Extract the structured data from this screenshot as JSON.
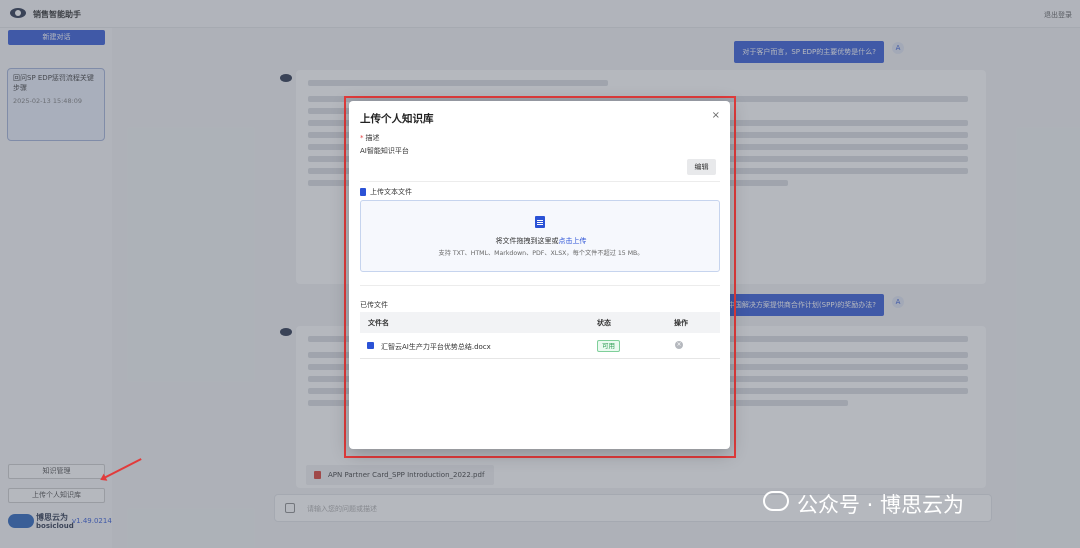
{
  "app": {
    "title": "销售智能助手",
    "logout_label": "退出登录"
  },
  "sidebar": {
    "new_chat_label": "新建对话",
    "history": [
      {
        "title": "回问SP EDP惩罚流程关键步骤",
        "time": "2025-02-13 15:48:09"
      }
    ],
    "knowledge_btn_label": "知识管理",
    "upload_personal_label": "上传个人知识库",
    "brand_name": "博思云为",
    "brand_sub": "bosicloud",
    "version": "v1.49.0214"
  },
  "chat": {
    "user_question_1": "对于客户而言，SP EDP的主要优势是什么?",
    "user_question_2": "中国解决方案提供商合作计划(SPP)的奖励办法?",
    "user_avatar": "A",
    "attachment_file": "APN Partner Card_SPP Introduction_2022.pdf",
    "input_placeholder": "请输入您的问题或描述"
  },
  "modal": {
    "title": "上传个人知识库",
    "close_icon": "×",
    "description_label": "描述",
    "description_required_mark": "*",
    "description_value": "AI智能知识平台",
    "edit_button": "编辑",
    "upload_section_label": "上传文本文件",
    "dropzone_text": "将文件拖拽到这里或",
    "dropzone_link": "点击上传",
    "dropzone_hint": "支持 TXT、HTML、Markdown、PDF、XLSX，每个文件不超过 15 MB。",
    "files_section_label": "已传文件",
    "table_headers": {
      "name": "文件名",
      "status": "状态",
      "action": "操作"
    },
    "files": [
      {
        "name": "汇智云AI生产力平台优势总结.docx",
        "status": "可用"
      }
    ]
  },
  "watermark": {
    "text": "公众号 · 博思云为"
  }
}
